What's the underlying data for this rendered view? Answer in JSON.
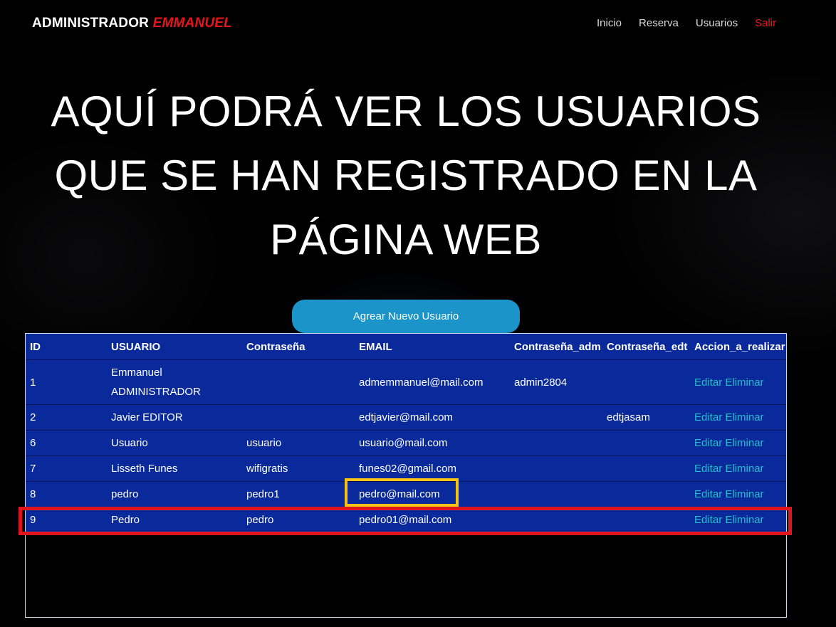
{
  "header": {
    "brand_prefix": "ADMINISTRADOR",
    "brand_name": "EMMANUEL",
    "nav": {
      "inicio": "Inicio",
      "reserva": "Reserva",
      "usuarios": "Usuarios",
      "salir": "Salir"
    }
  },
  "hero": {
    "title": "AQUÍ PODRÁ VER LOS USUARIOS QUE SE HAN REGISTRADO EN LA PÁGINA WEB"
  },
  "actions": {
    "add_user_label": "Agrear Nuevo Usuario"
  },
  "table": {
    "columns": [
      "ID",
      "USUARIO",
      "Contraseña",
      "EMAIL",
      "Contraseña_adm",
      "Contraseña_edt",
      "Accion_a_realizar"
    ],
    "edit_label": "Editar",
    "delete_label": "Eliminar",
    "rows": [
      {
        "id": "1",
        "usuario": "Emmanuel ADMINISTRADOR",
        "contrasena": "",
        "email": "admemmanuel@mail.com",
        "contrasena_adm": "admin2804",
        "contrasena_edt": ""
      },
      {
        "id": "2",
        "usuario": "Javier EDITOR",
        "contrasena": "",
        "email": "edtjavier@mail.com",
        "contrasena_adm": "",
        "contrasena_edt": "edtjasam"
      },
      {
        "id": "6",
        "usuario": "Usuario",
        "contrasena": "usuario",
        "email": "usuario@mail.com",
        "contrasena_adm": "",
        "contrasena_edt": ""
      },
      {
        "id": "7",
        "usuario": "Lisseth Funes",
        "contrasena": "wifigratis",
        "email": "funes02@gmail.com",
        "contrasena_adm": "",
        "contrasena_edt": ""
      },
      {
        "id": "8",
        "usuario": "pedro",
        "contrasena": "pedro1",
        "email": "pedro@mail.com",
        "contrasena_adm": "",
        "contrasena_edt": ""
      },
      {
        "id": "9",
        "usuario": "Pedro",
        "contrasena": "pedro",
        "email": "pedro01@mail.com",
        "contrasena_adm": "",
        "contrasena_edt": ""
      }
    ]
  },
  "highlights": {
    "yellow_color": "#f7c215",
    "red_color": "#e0141c"
  }
}
